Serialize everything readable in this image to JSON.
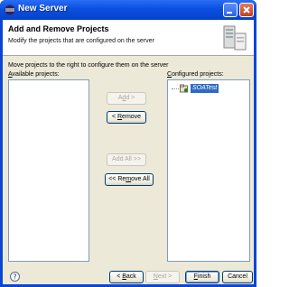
{
  "window": {
    "title": "New Server"
  },
  "banner": {
    "title": "Add and Remove Projects",
    "description": "Modify the projects that are configured on the server",
    "icon": "server-wizard-icon"
  },
  "instruction": "Move projects to the right to configure them on the server",
  "available": {
    "label_prefix": "",
    "label_mnemonic": "A",
    "label_rest": "vailable projects:",
    "items": []
  },
  "configured": {
    "label_prefix": "",
    "label_mnemonic": "C",
    "label_rest": "onfigured projects:",
    "items": [
      {
        "label": "SOATest",
        "selected": true,
        "icon": "project-icon"
      }
    ]
  },
  "buttons": {
    "add": {
      "pre": "A",
      "mn": "d",
      "post": "d >",
      "enabled": false
    },
    "remove": {
      "pre": "< ",
      "mn": "R",
      "post": "emove",
      "enabled": true
    },
    "add_all": {
      "pre": "Add All >>",
      "mn": "",
      "post": "",
      "enabled": false
    },
    "remove_all": {
      "pre": "<< Re",
      "mn": "m",
      "post": "ove All",
      "enabled": true
    }
  },
  "footer": {
    "help_icon": "help-icon",
    "back": {
      "pre": "< ",
      "mn": "B",
      "post": "ack",
      "enabled": true
    },
    "next": {
      "pre": "",
      "mn": "N",
      "post": "ext >",
      "enabled": false
    },
    "finish": {
      "pre": "",
      "mn": "F",
      "post": "inish",
      "enabled": true
    },
    "cancel": {
      "pre": "Cancel",
      "mn": "",
      "post": "",
      "enabled": true
    }
  },
  "colors": {
    "titlebar": "#0a4fe0",
    "dialog_bg": "#ece9d8",
    "selection": "#316ac5"
  }
}
